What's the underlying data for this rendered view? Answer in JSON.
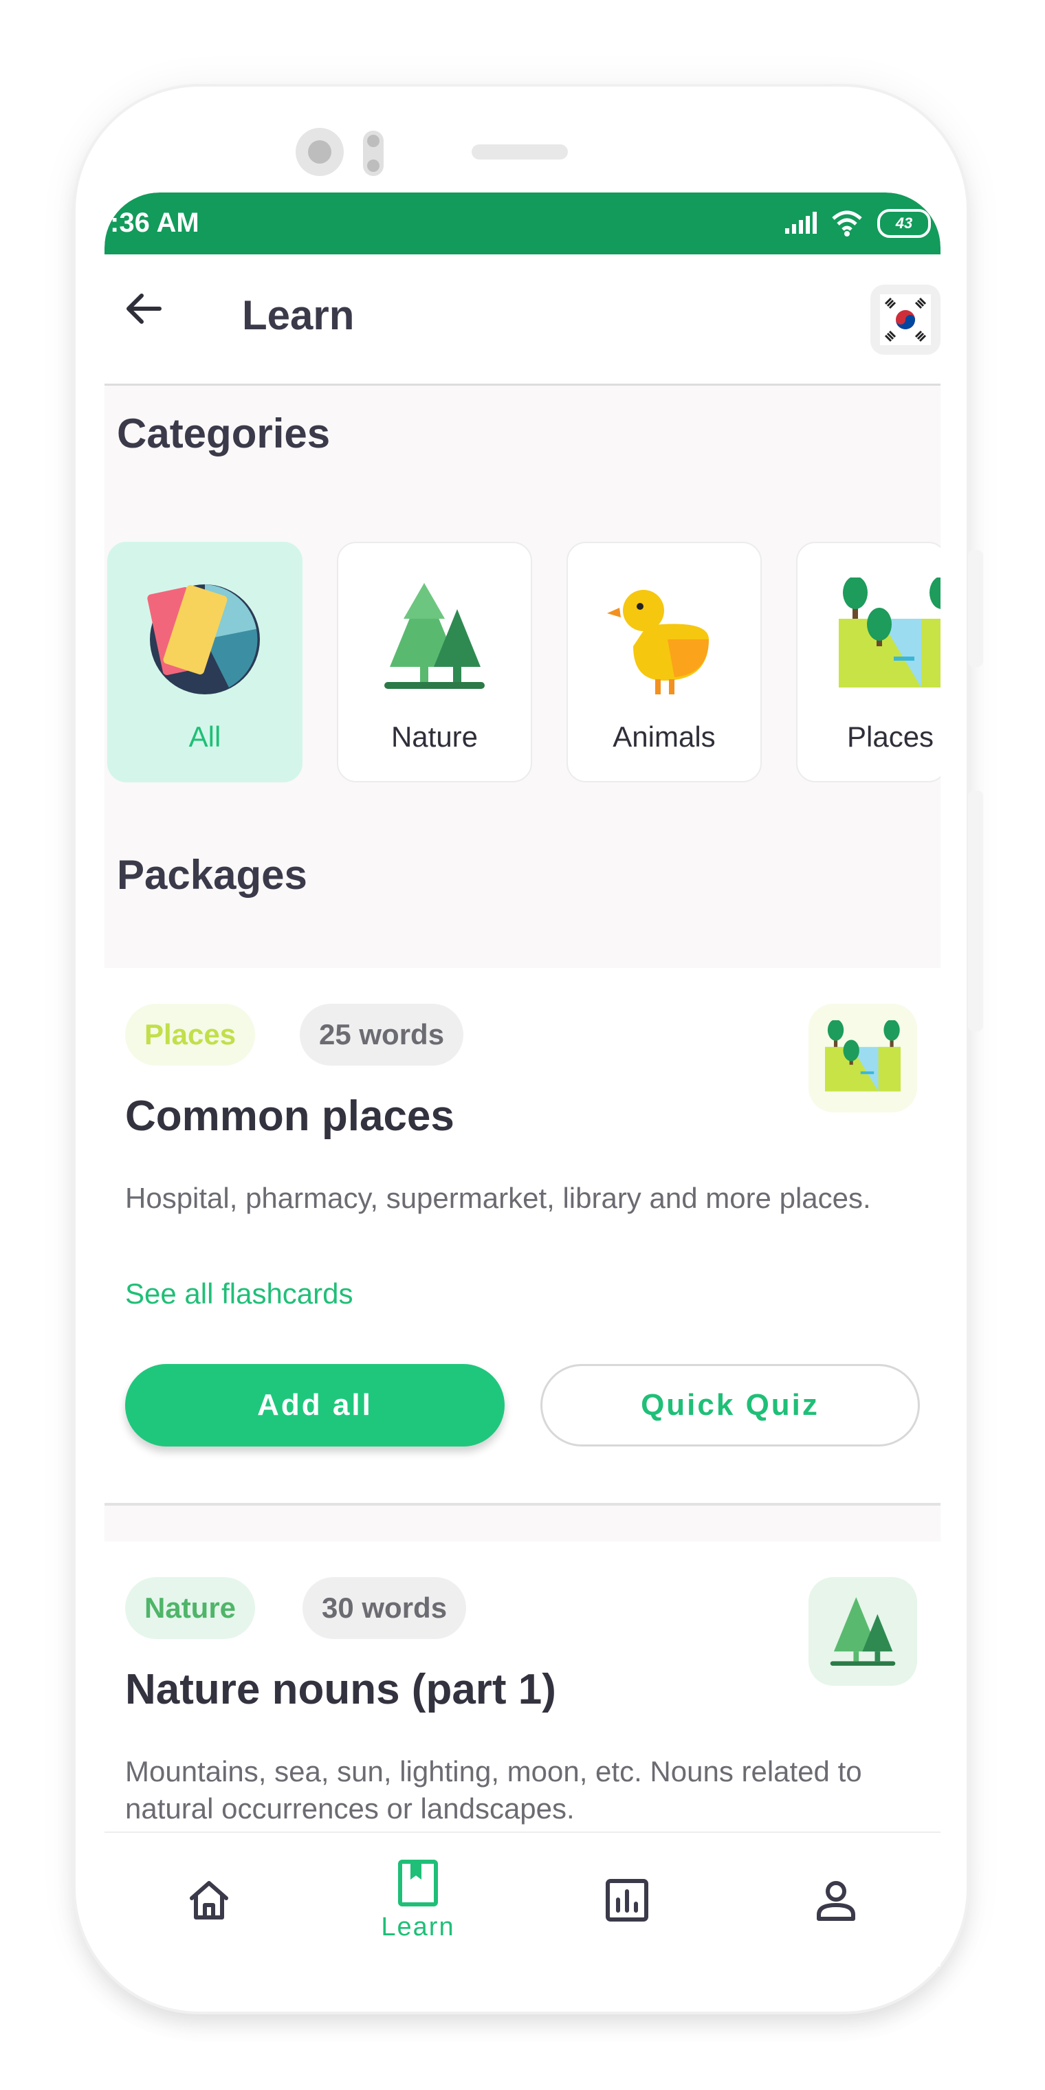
{
  "status_bar": {
    "time": ":36 AM",
    "battery": "43"
  },
  "app_bar": {
    "title": "Learn",
    "language_flag": "korea-flag-icon"
  },
  "sections": {
    "categories_title": "Categories",
    "packages_title": "Packages"
  },
  "categories": [
    {
      "label": "All",
      "icon": "all-categories-icon",
      "selected": true
    },
    {
      "label": "Nature",
      "icon": "trees-icon",
      "selected": false
    },
    {
      "label": "Animals",
      "icon": "duck-icon",
      "selected": false
    },
    {
      "label": "Places",
      "icon": "park-map-icon",
      "selected": false
    }
  ],
  "packages": [
    {
      "tag": "Places",
      "word_count": "25 words",
      "title": "Common places",
      "description": "Hospital, pharmacy, supermarket, library and more places.",
      "link": "See all flashcards",
      "primary_button": "Add all",
      "secondary_button": "Quick Quiz",
      "thumb_icon": "park-map-icon"
    },
    {
      "tag": "Nature",
      "word_count": "30 words",
      "title": "Nature nouns (part 1)",
      "description": "Mountains, sea, sun, lighting, moon, etc. Nouns related to natural occurrences or landscapes.",
      "thumb_icon": "trees-icon"
    }
  ],
  "bottom_nav": [
    {
      "label": "",
      "icon": "home-icon",
      "active": false
    },
    {
      "label": "Learn",
      "icon": "bookmark-book-icon",
      "active": true
    },
    {
      "label": "",
      "icon": "stats-icon",
      "active": false
    },
    {
      "label": "",
      "icon": "profile-icon",
      "active": false
    }
  ],
  "colors": {
    "status_bar": "#129b5b",
    "accent": "#1fc77d",
    "places_tag_bg": "#f5fbe7",
    "places_tag_text": "#c2df4a",
    "nature_tag_bg": "#e6f6ec",
    "nature_tag_text": "#4fb569"
  }
}
